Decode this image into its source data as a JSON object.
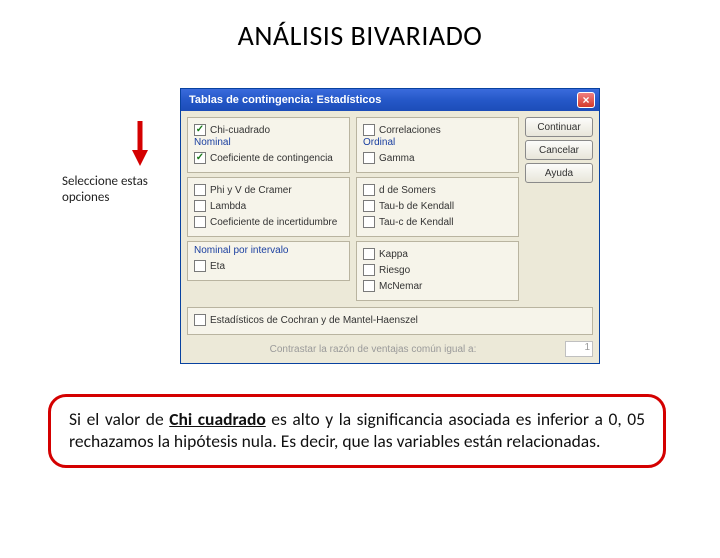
{
  "page": {
    "title": "ANÁLISIS BIVARIADO"
  },
  "dialog": {
    "title": "Tablas de contingencia: Estadísticos",
    "close_glyph": "×",
    "left": {
      "top": [
        {
          "label": "Chi-cuadrado",
          "checked": true
        },
        {
          "title": "Nominal"
        },
        {
          "label": "Coeficiente de contingencia",
          "checked": true
        }
      ],
      "bottom": [
        {
          "label": "Phi y V de Cramer",
          "checked": false
        },
        {
          "label": "Lambda",
          "checked": false
        },
        {
          "label": "Coeficiente de incertidumbre",
          "checked": false
        }
      ],
      "nominal_interval_title": "Nominal por intervalo",
      "eta": {
        "label": "Eta",
        "checked": false
      }
    },
    "right": {
      "top": [
        {
          "label": "Correlaciones",
          "checked": false
        },
        {
          "title": "Ordinal"
        },
        {
          "label": "Gamma",
          "checked": false
        }
      ],
      "bottom": [
        {
          "label": "d de Somers",
          "checked": false
        },
        {
          "label": "Tau-b de Kendall",
          "checked": false
        },
        {
          "label": "Tau-c de Kendall",
          "checked": false
        }
      ],
      "extras": [
        {
          "label": "Kappa",
          "checked": false
        },
        {
          "label": "Riesgo",
          "checked": false
        },
        {
          "label": "McNemar",
          "checked": false
        }
      ]
    },
    "cochran": {
      "label": "Estadísticos de Cochran y de Mantel-Haenszel",
      "checked": false
    },
    "contrast": {
      "label": "Contrastar la razón de ventajas común igual a:",
      "value": "1"
    },
    "buttons": {
      "continue": "Continuar",
      "cancel": "Cancelar",
      "help": "Ayuda"
    }
  },
  "callout": "Seleccione estas opciones",
  "note": {
    "pre": "Si el valor de ",
    "chi": "Chi cuadrado",
    "post": " es alto y la significancia asociada es inferior a 0, 05 rechazamos la hipótesis nula. Es decir, que las variables están relacionadas."
  }
}
